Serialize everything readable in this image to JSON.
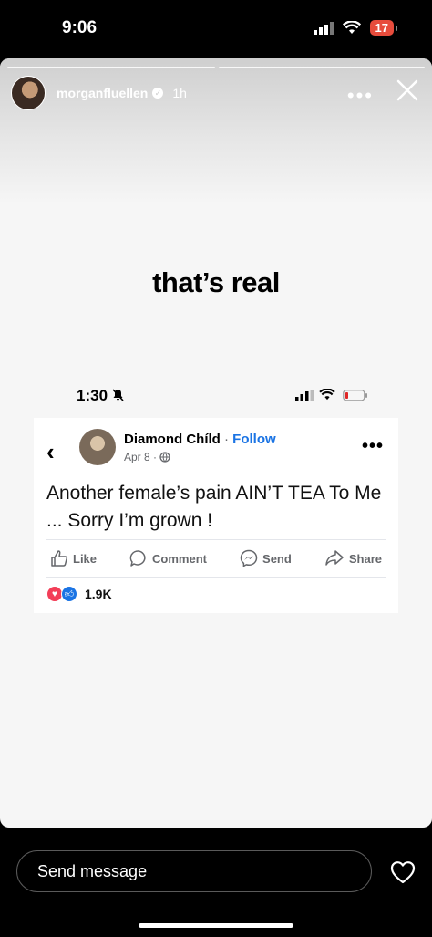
{
  "status_bar": {
    "time": "9:06",
    "battery": "17"
  },
  "story": {
    "username": "morganfluellen",
    "age": "1h",
    "caption": "that’s real"
  },
  "embedded_status": {
    "time": "1:30"
  },
  "post": {
    "author": "Diamond Chíld",
    "follow_label": "Follow",
    "date": "Apr 8",
    "text": "Another female’s pain AIN’T TEA To Me ... Sorry I’m grown !",
    "actions": {
      "like": "Like",
      "comment": "Comment",
      "send": "Send",
      "share": "Share"
    },
    "reaction_count": "1.9K"
  },
  "bottom": {
    "placeholder": "Send message"
  }
}
